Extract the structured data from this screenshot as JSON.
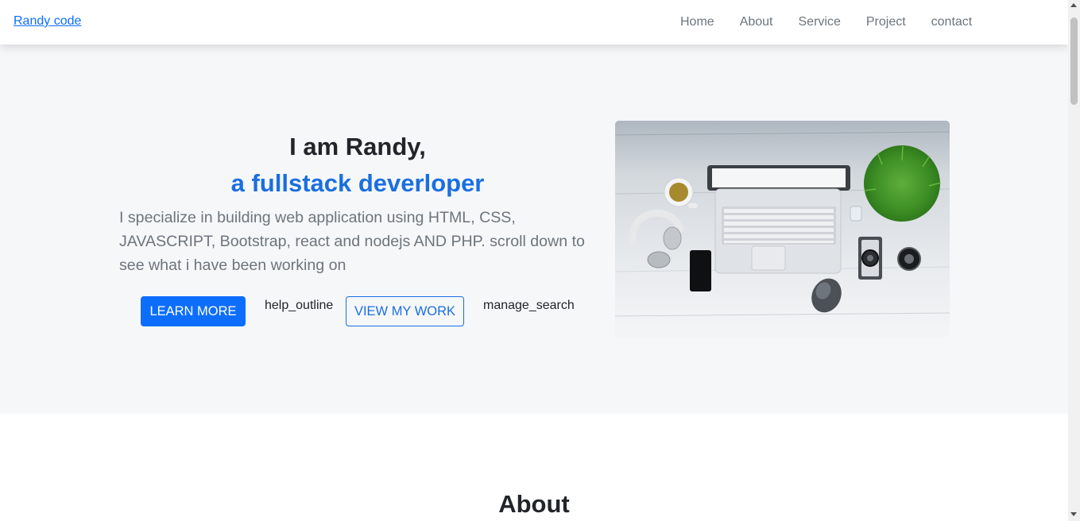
{
  "navbar": {
    "brand": "Randy code",
    "links": [
      "Home",
      "About",
      "Service",
      "Project",
      "contact"
    ]
  },
  "hero": {
    "title": "I am Randy,",
    "subtitle": "a fullstack deverloper",
    "description": "I specialize in building web application using HTML, CSS, JAVASCRIPT, Bootstrap, react and nodejs AND PHP. scroll down to see what i have been working on",
    "learn_more_label": "LEARN MORE",
    "help_icon_text": "help_outline",
    "view_work_label": "VIEW MY WORK",
    "manage_icon_text": "manage_search"
  },
  "about": {
    "title": "About"
  },
  "colors": {
    "primary": "#0d6efd",
    "accent_text": "#1a6fe0",
    "muted": "#6c757d",
    "hero_bg": "#f6f7f9"
  }
}
